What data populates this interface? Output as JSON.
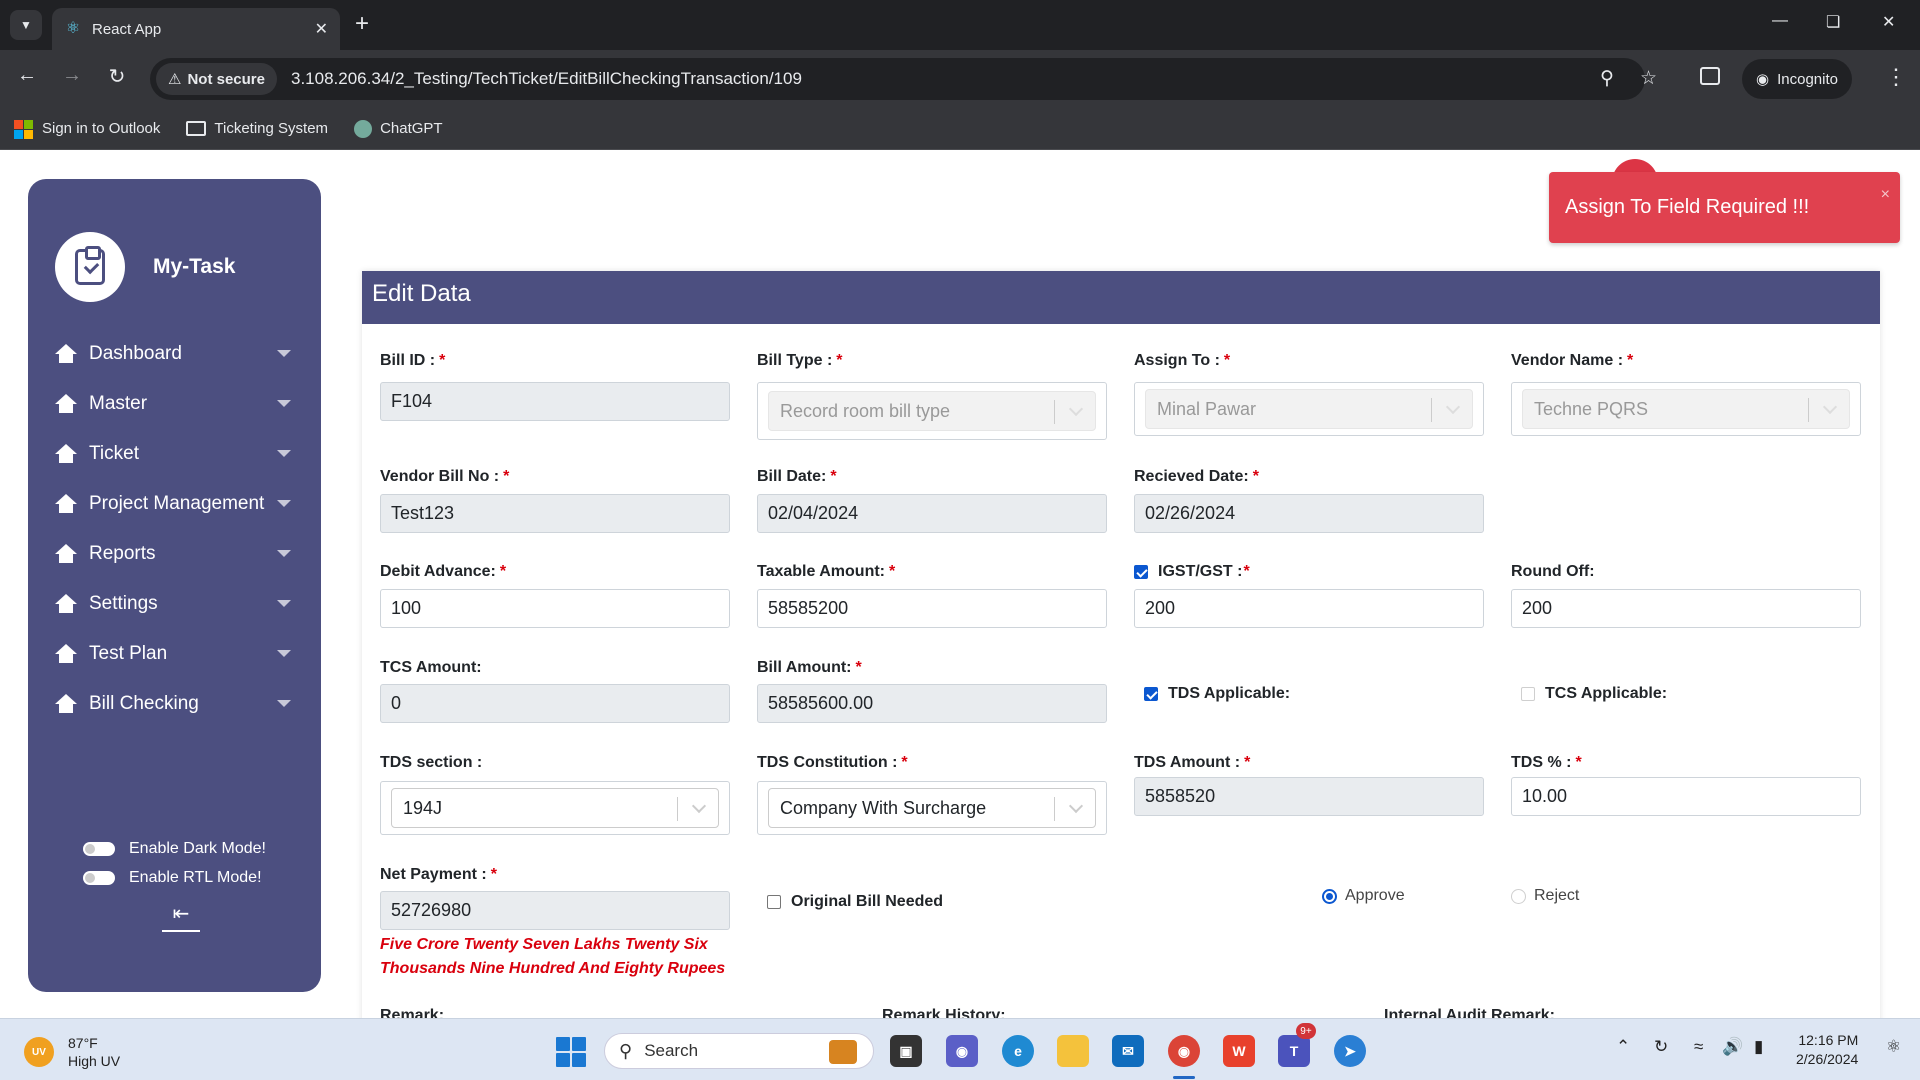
{
  "browser": {
    "tab_title": "React App",
    "security_label": "Not secure",
    "url": "3.108.206.34/2_Testing/TechTicket/EditBillCheckingTransaction/109",
    "incognito_label": "Incognito",
    "bookmarks": [
      {
        "label": "Sign in to Outlook",
        "icon": "microsoft-icon"
      },
      {
        "label": "Ticketing System",
        "icon": "folder-icon"
      },
      {
        "label": "ChatGPT",
        "icon": "chatgpt-icon"
      }
    ]
  },
  "sidebar": {
    "brand": "My-Task",
    "items": [
      {
        "label": "Dashboard"
      },
      {
        "label": "Master"
      },
      {
        "label": "Ticket"
      },
      {
        "label": "Project Management"
      },
      {
        "label": "Reports"
      },
      {
        "label": "Settings"
      },
      {
        "label": "Test Plan"
      },
      {
        "label": "Bill Checking"
      }
    ],
    "dark_mode_label": "Enable Dark Mode!",
    "rtl_mode_label": "Enable RTL Mode!"
  },
  "toast": {
    "message": "Assign To Field Required !!!",
    "close": "×"
  },
  "form": {
    "title": "Edit Data",
    "bill_id": {
      "label": "Bill ID :",
      "value": "F104"
    },
    "bill_type": {
      "label": "Bill Type :",
      "value": "Record room bill type"
    },
    "assign_to": {
      "label": "Assign To :",
      "value": "Minal Pawar"
    },
    "vendor_name": {
      "label": "Vendor Name :",
      "value": "Techne PQRS"
    },
    "vendor_bill_no": {
      "label": "Vendor Bill No :",
      "value": "Test123"
    },
    "bill_date": {
      "label": "Bill Date:",
      "value": "02/04/2024"
    },
    "received_date": {
      "label": "Recieved Date:",
      "value": "02/26/2024"
    },
    "debit_advance": {
      "label": "Debit Advance:",
      "value": "100"
    },
    "taxable_amount": {
      "label": "Taxable Amount:",
      "value": "58585200"
    },
    "igst_gst": {
      "label": "IGST/GST :",
      "value": "200",
      "checked": true
    },
    "round_off": {
      "label": "Round Off:",
      "value": "200"
    },
    "tcs_amount": {
      "label": "TCS Amount:",
      "value": "0"
    },
    "bill_amount": {
      "label": "Bill Amount:",
      "value": "58585600.00"
    },
    "tds_applicable": {
      "label": "TDS Applicable:",
      "checked": true
    },
    "tcs_applicable": {
      "label": "TCS Applicable:",
      "checked": false
    },
    "tds_section": {
      "label": "TDS section :",
      "value": "194J"
    },
    "tds_constitution": {
      "label": "TDS Constitution :",
      "value": "Company With Surcharge"
    },
    "tds_amount": {
      "label": "TDS Amount :",
      "value": "5858520"
    },
    "tds_percent": {
      "label": "TDS % :",
      "value": "10.00"
    },
    "net_payment": {
      "label": "Net Payment :",
      "value": "52726980",
      "words": "Five Crore Twenty Seven Lakhs Twenty Six Thousands Nine Hundred And Eighty Rupees"
    },
    "original_bill_needed": {
      "label": "Original Bill Needed",
      "checked": false
    },
    "approve_label": "Approve",
    "reject_label": "Reject",
    "decision": "Approve",
    "remark_label": "Remark:",
    "remark_history_label": "Remark History:",
    "internal_audit_remark_label": "Internal Audit Remark:",
    "required_mark": "*"
  },
  "taskbar": {
    "temperature": "87°F",
    "weather": "High UV",
    "uv_badge": "UV",
    "search_placeholder": "Search",
    "notification_count": "9+",
    "time": "12:16 PM",
    "date": "2/26/2024"
  }
}
